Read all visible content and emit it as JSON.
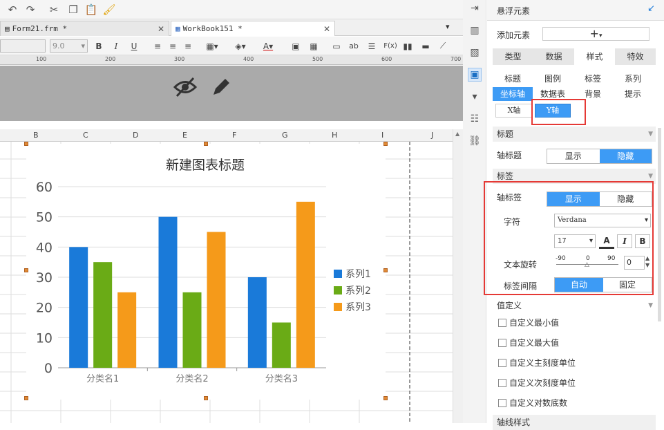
{
  "tabs": [
    {
      "label": "Form21.frm *"
    },
    {
      "label": "WorkBook151 *"
    }
  ],
  "format": {
    "font_size": "9.0",
    "bold": "B",
    "italic": "I",
    "underline": "U",
    "fx": "F(x)",
    "ab": "ab"
  },
  "ruler": {
    "marks": [
      "100",
      "200",
      "300",
      "400",
      "500",
      "600",
      "700"
    ]
  },
  "columns": [
    "B",
    "C",
    "D",
    "E",
    "F",
    "G",
    "H",
    "I",
    "J"
  ],
  "chart_data": {
    "type": "bar",
    "title": "新建图表标题",
    "categories": [
      "分类名1",
      "分类名2",
      "分类名3"
    ],
    "series": [
      {
        "name": "系列1",
        "values": [
          40,
          50,
          30
        ],
        "color": "#1a7ad9"
      },
      {
        "name": "系列2",
        "values": [
          35,
          25,
          15
        ],
        "color": "#6aab16"
      },
      {
        "name": "系列3",
        "values": [
          25,
          45,
          55
        ],
        "color": "#f59a1a"
      }
    ],
    "ylim": [
      0,
      60
    ],
    "yticks": [
      0,
      10,
      20,
      30,
      40,
      50,
      60
    ],
    "legend": "right",
    "grid": true
  },
  "panel": {
    "title": "悬浮元素",
    "add_label": "添加元素",
    "add_btn": "+",
    "main_tabs": [
      "类型",
      "数据",
      "样式",
      "特效"
    ],
    "sub_tabs_row1": [
      "标题",
      "图例",
      "标签",
      "系列"
    ],
    "sub_tabs_row2": [
      "坐标轴",
      "数据表",
      "背景",
      "提示"
    ],
    "axis_tabs": [
      "X轴",
      "Y轴"
    ],
    "sec_title": "标题",
    "axis_title_label": "轴标题",
    "show": "显示",
    "hide": "隐藏",
    "sec_label": "标签",
    "axis_label_label": "轴标签",
    "font_label": "字符",
    "font_value": "Verdana",
    "font_size": "17",
    "rotate_label": "文本旋转",
    "rotate_min": "-90",
    "rotate_mid": "0",
    "rotate_max": "90",
    "rotate_value": "0",
    "interval_label": "标签间隔",
    "auto": "自动",
    "fixed": "固定",
    "sec_value": "值定义",
    "custom": [
      "自定义最小值",
      "自定义最大值",
      "自定义主刻度单位",
      "自定义次刻度单位",
      "自定义对数底数"
    ],
    "sec_axis_line": "轴线样式"
  },
  "colors": {
    "accent": "#3d9bf5",
    "highlight": "#e53935"
  }
}
